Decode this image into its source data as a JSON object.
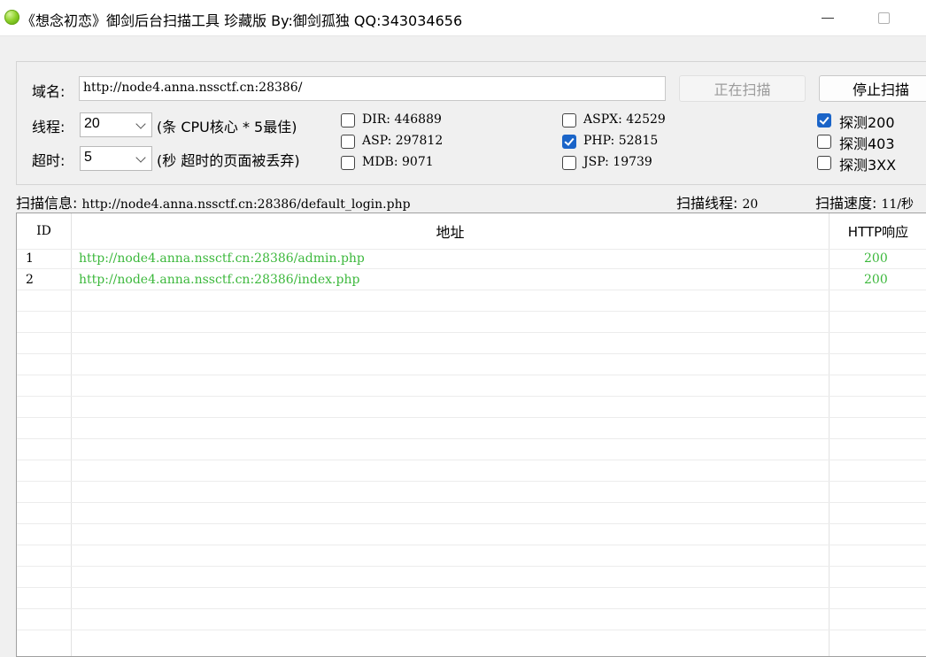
{
  "window": {
    "title": "《想念初恋》御剑后台扫描工具 珍藏版 By:御剑孤独 QQ:343034656"
  },
  "form": {
    "domain_label": "域名:",
    "domain_value": "http://node4.anna.nssctf.cn:28386/",
    "threads_label": "线程:",
    "threads_value": "20",
    "threads_hint": "(条 CPU核心 * 5最佳)",
    "timeout_label": "超时:",
    "timeout_value": "5",
    "timeout_hint": "(秒 超时的页面被丢弃)",
    "scanning_button": "正在扫描",
    "stop_button": "停止扫描"
  },
  "dictionaries": [
    {
      "label": "DIR: 446889",
      "checked": false
    },
    {
      "label": "ASP: 297812",
      "checked": false
    },
    {
      "label": "MDB: 9071",
      "checked": false
    },
    {
      "label": "ASPX: 42529",
      "checked": false
    },
    {
      "label": "PHP: 52815",
      "checked": true
    },
    {
      "label": "JSP: 19739",
      "checked": false
    }
  ],
  "detect": [
    {
      "label": "探测200",
      "checked": true
    },
    {
      "label": "探测403",
      "checked": false
    },
    {
      "label": "探测3XX",
      "checked": false
    }
  ],
  "status": {
    "info_label": "扫描信息:",
    "info_value": "http://node4.anna.nssctf.cn:28386/default_login.php",
    "threads_label": "扫描线程:",
    "threads_value": "20",
    "speed_label": "扫描速度:",
    "speed_value": "11/秒"
  },
  "table": {
    "columns": [
      "ID",
      "地址",
      "HTTP响应"
    ],
    "rows": [
      {
        "id": "1",
        "url": "http://node4.anna.nssctf.cn:28386/admin.php",
        "code": "200"
      },
      {
        "id": "2",
        "url": "http://node4.anna.nssctf.cn:28386/index.php",
        "code": "200"
      }
    ]
  },
  "colors": {
    "result_text": "#3cb83c",
    "checkbox_checked": "#1a64c8"
  }
}
